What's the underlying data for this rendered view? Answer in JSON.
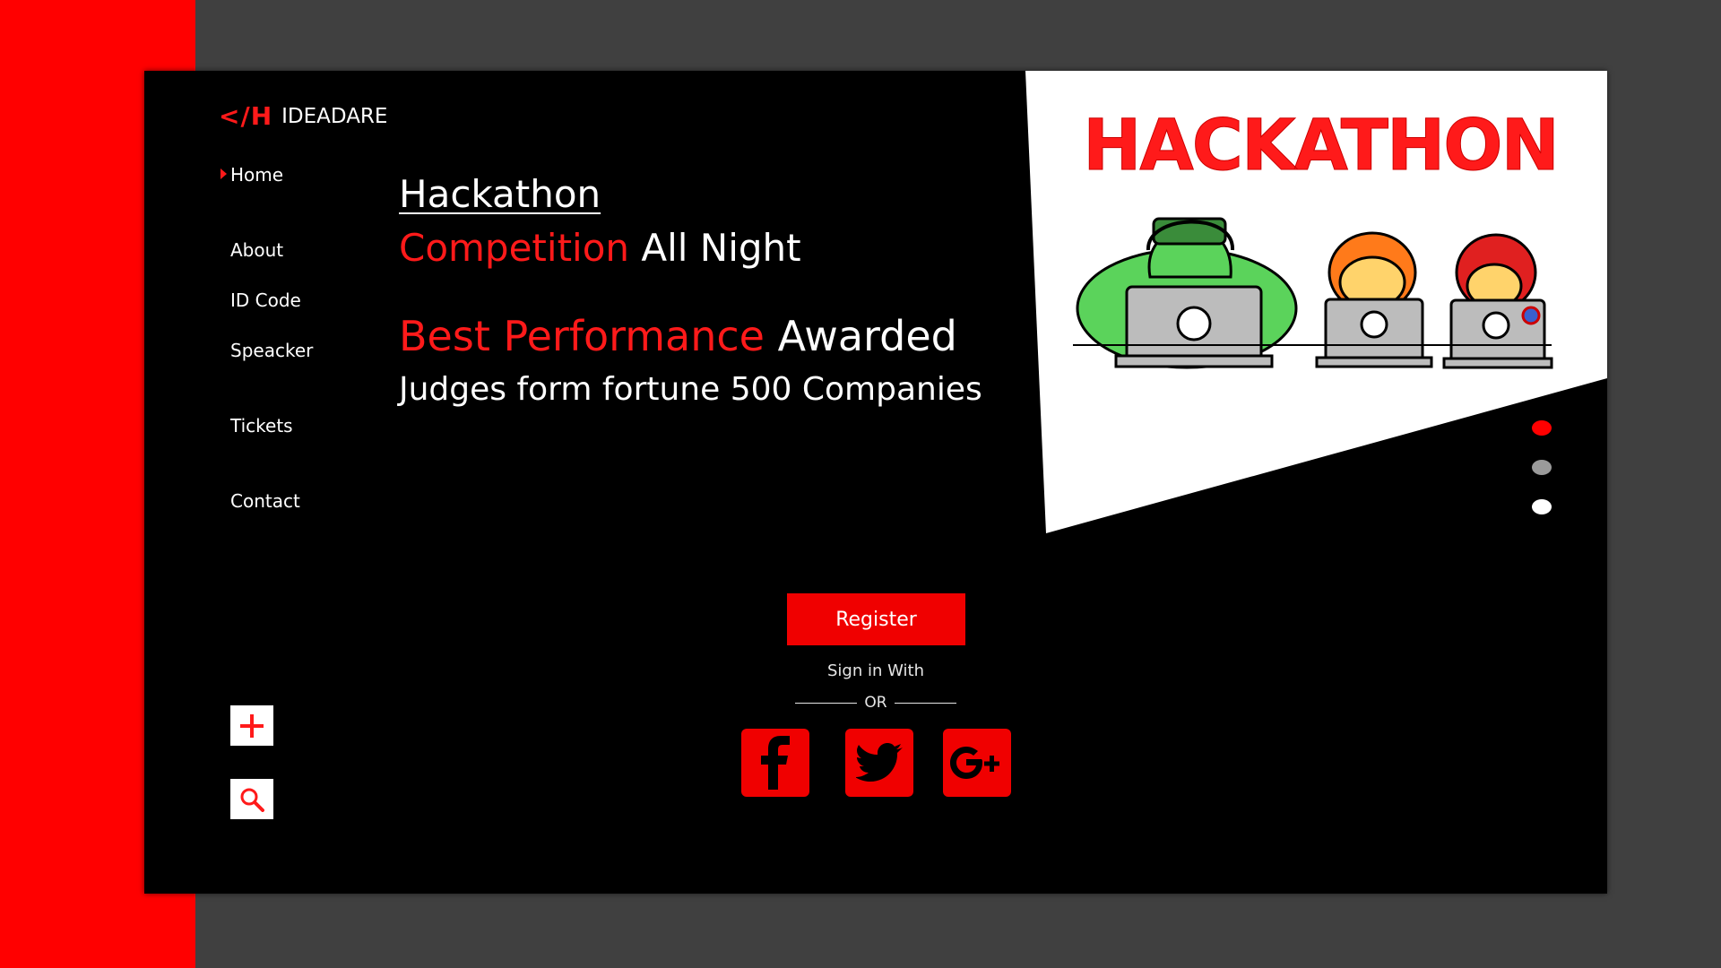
{
  "brand": {
    "mark": "</H",
    "name": "IDEADARE"
  },
  "nav": {
    "items": [
      {
        "label": "Home"
      },
      {
        "label": "About"
      },
      {
        "label": "ID Code"
      },
      {
        "label": "Speacker"
      },
      {
        "label": "Tickets"
      },
      {
        "label": "Contact"
      }
    ],
    "active": "Home"
  },
  "hero": {
    "line1": "Hackathon",
    "line2_red": "Competition",
    "line2_white": " All Night",
    "line3_red": "Best Performance",
    "line3_white": " Awarded",
    "line4": "Judges form fortune 500 Companies",
    "banner_text": "HACKATHON"
  },
  "register": {
    "button_label": "Register",
    "sign_in_text": "Sign in With",
    "or_text": "OR"
  },
  "social": [
    {
      "icon": "facebook-icon"
    },
    {
      "icon": "twitter-icon"
    },
    {
      "icon": "google-plus-icon"
    }
  ],
  "tools": [
    {
      "icon": "plus-icon"
    },
    {
      "icon": "search-icon"
    }
  ],
  "slider": {
    "dots": 3,
    "active_index": 0
  },
  "colors": {
    "accent": "#ff0000",
    "background": "#000000",
    "outer": "#404040"
  }
}
